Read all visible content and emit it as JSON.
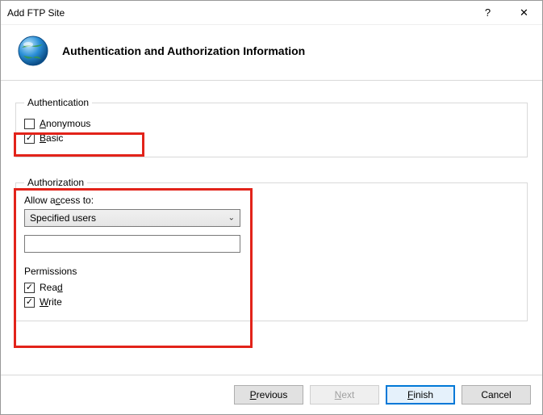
{
  "window": {
    "title": "Add FTP Site"
  },
  "header": {
    "title": "Authentication and Authorization Information"
  },
  "auth_group": {
    "legend": "Authentication",
    "anonymous_label": "Anonymous",
    "anonymous_checked": false,
    "basic_label": "Basic",
    "basic_checked": true
  },
  "authz_group": {
    "legend": "Authorization",
    "allow_label": "Allow access to:",
    "dropdown_value": "Specified users",
    "textbox_value": "",
    "permissions_label": "Permissions",
    "read_label": "Read",
    "read_checked": true,
    "write_label": "Write",
    "write_checked": true
  },
  "buttons": {
    "previous": "Previous",
    "next": "Next",
    "finish": "Finish",
    "cancel": "Cancel"
  }
}
